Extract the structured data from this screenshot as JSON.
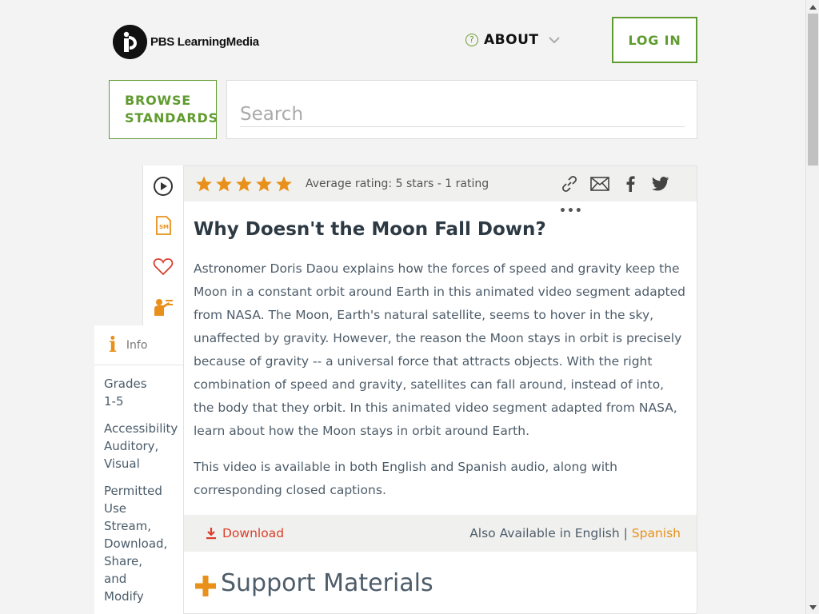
{
  "header": {
    "logo_text": "PBS LearningMedia",
    "about_label": "ABOUT",
    "login_label": "LOG IN"
  },
  "search": {
    "browse_line1": "BROWSE",
    "browse_line2": "STANDARDS",
    "placeholder": "Search"
  },
  "rail": {
    "icons": [
      "play-icon",
      "sm-document-icon",
      "heart-icon",
      "teacher-icon"
    ]
  },
  "info": {
    "tab_label": "Info",
    "grades_label": "Grades",
    "grades_value": "1-5",
    "accessibility_label": "Accessibility",
    "accessibility_value1": "Auditory,",
    "accessibility_value2": "Visual",
    "permitted_label1": "Permitted",
    "permitted_label2": "Use",
    "permitted_value1": "Stream,",
    "permitted_value2": "Download,",
    "permitted_value3": "Share,",
    "permitted_value4": "and",
    "permitted_value5": "Modify"
  },
  "rating": {
    "stars": 5,
    "text": "Average rating: 5 stars - 1 rating"
  },
  "resource": {
    "title": "Why Doesn't the Moon Fall Down?",
    "paragraph1": "Astronomer Doris Daou explains how the forces of speed and gravity keep the Moon in a constant orbit around Earth in this animated video segment adapted from NASA. The Moon, Earth's natural satellite, seems to hover in the sky, unaffected by gravity. However, the reason the Moon stays in orbit is precisely because of gravity -- a universal force that attracts objects. With the right combination of speed and gravity, satellites can fall around, instead of into, the body that they orbit. In this animated video segment adapted from NASA, learn about how the Moon stays in orbit around Earth.",
    "paragraph2": "This video is available in both English and Spanish audio, along with corresponding closed captions.",
    "more_label": "•••"
  },
  "download": {
    "label": "Download",
    "also_prefix": "Also Available in English | ",
    "spanish_label": "Spanish"
  },
  "support": {
    "heading": "Support Materials"
  },
  "colors": {
    "green": "#5f9b2f",
    "orange": "#e8901a",
    "red": "#d93f2a"
  }
}
